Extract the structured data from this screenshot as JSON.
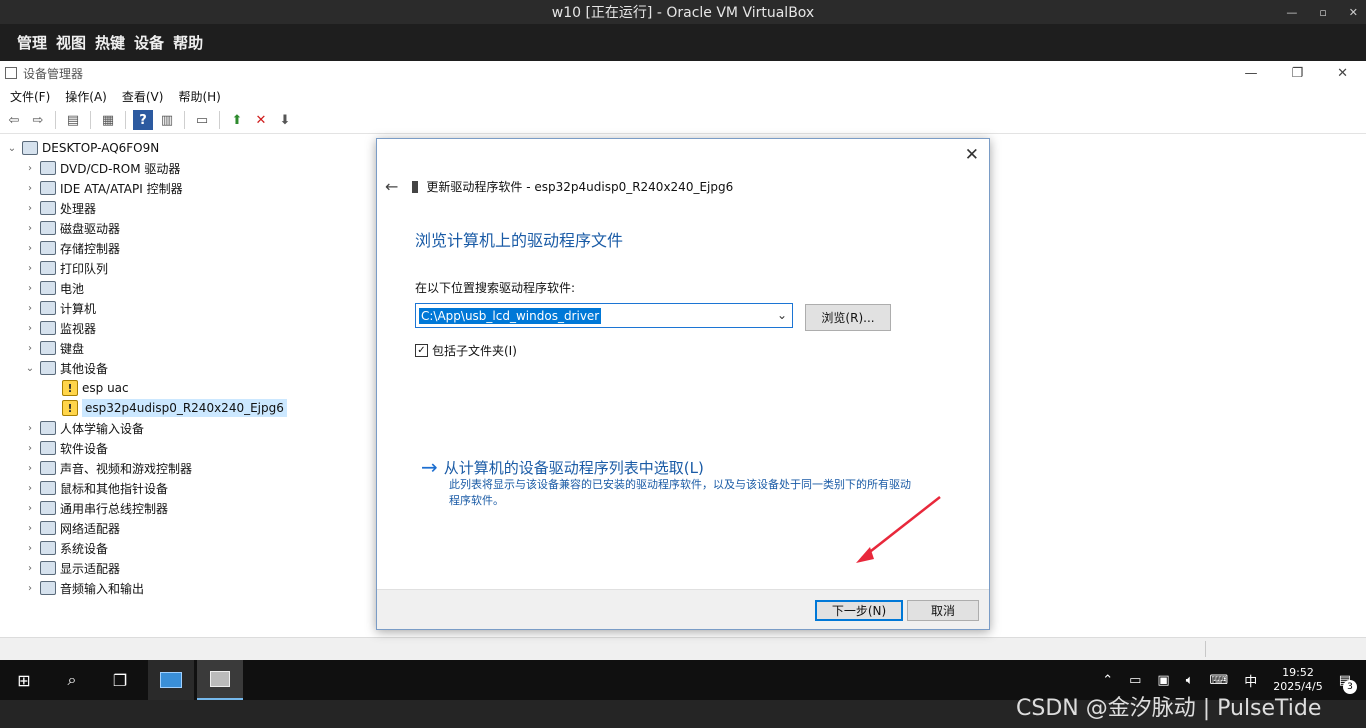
{
  "vbox": {
    "title": "w10 [正在运行] - Oracle VM VirtualBox",
    "menu": [
      "管理",
      "视图",
      "热键",
      "设备",
      "帮助"
    ]
  },
  "device_manager": {
    "title": "设备管理器",
    "menu": [
      "文件(F)",
      "操作(A)",
      "查看(V)",
      "帮助(H)"
    ],
    "tree": {
      "root": "DESKTOP-AQ6FO9N",
      "categories": [
        "DVD/CD-ROM 驱动器",
        "IDE ATA/ATAPI 控制器",
        "处理器",
        "磁盘驱动器",
        "存储控制器",
        "打印队列",
        "电池",
        "计算机",
        "监视器",
        "键盘",
        "其他设备"
      ],
      "other_devices": [
        "esp uac",
        "esp32p4udisp0_R240x240_Ejpg6"
      ],
      "categories_after": [
        "人体学输入设备",
        "软件设备",
        "声音、视频和游戏控制器",
        "鼠标和其他指针设备",
        "通用串行总线控制器",
        "网络适配器",
        "系统设备",
        "显示适配器",
        "音频输入和输出"
      ]
    }
  },
  "dialog": {
    "header": "更新驱动程序软件 - esp32p4udisp0_R240x240_Ejpg6",
    "heading": "浏览计算机上的驱动程序文件",
    "search_label": "在以下位置搜索驱动程序软件:",
    "path_value": "C:\\App\\usb_lcd_windos_driver",
    "browse_label": "浏览(R)...",
    "include_subfolders": "包括子文件夹(I)",
    "pick_link": "从计算机的设备驱动程序列表中选取(L)",
    "pick_desc": "此列表将显示与该设备兼容的已安装的驱动程序软件，以及与该设备处于同一类别下的所有驱动程序软件。",
    "next_label": "下一步(N)",
    "cancel_label": "取消"
  },
  "taskbar": {
    "time": "19:52",
    "date": "2025/4/5",
    "ime": "中",
    "notifications": "3"
  },
  "watermark": "CSDN @金汐脉动 | PulseTide",
  "colors": {
    "accent": "#0078d7",
    "link": "#1a5ba6",
    "warning_arrow": "#e8283b"
  }
}
